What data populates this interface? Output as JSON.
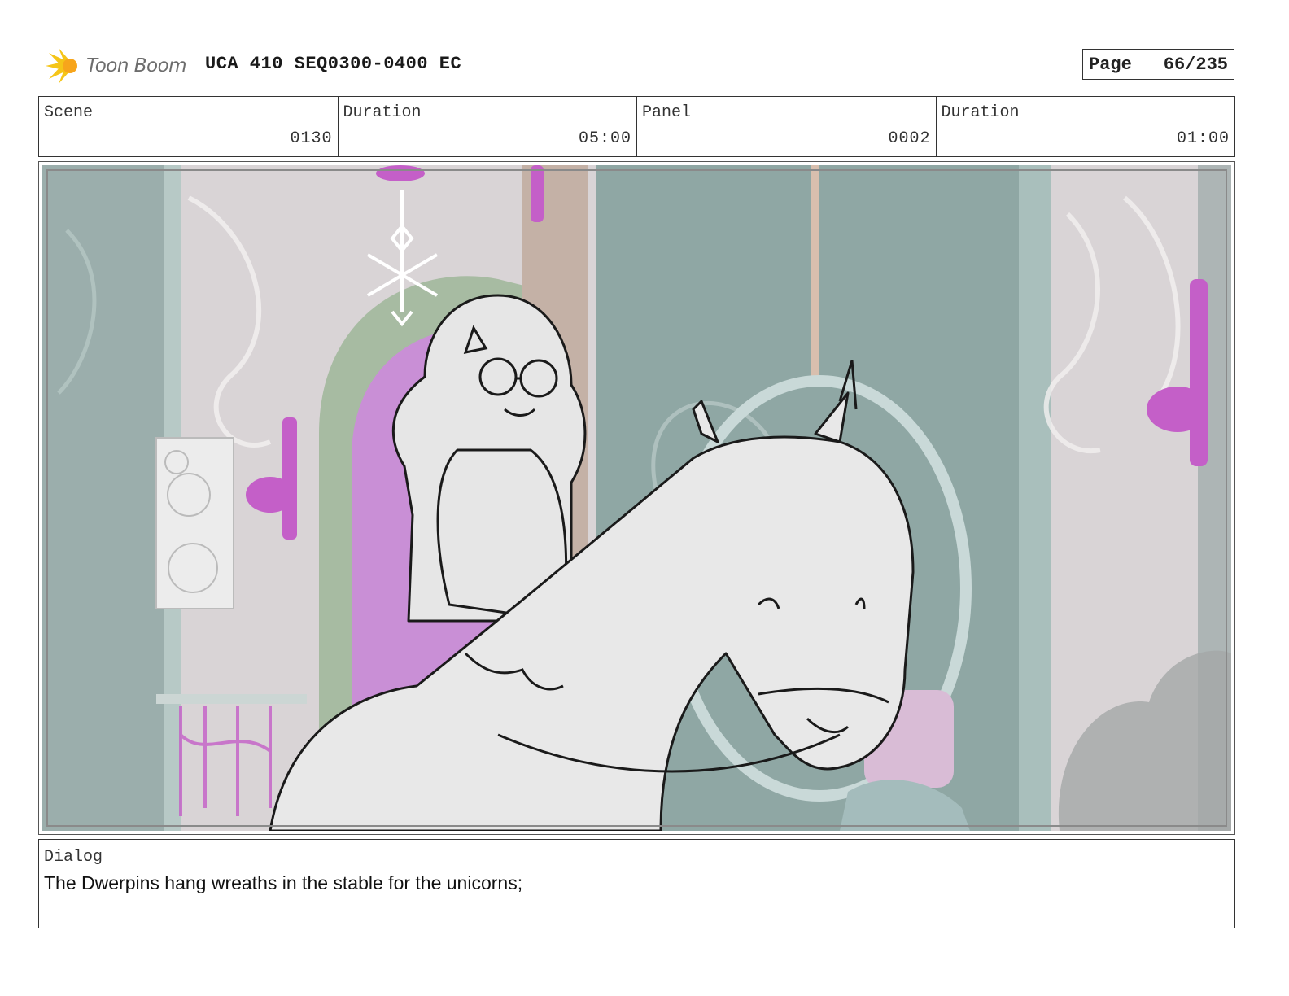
{
  "header": {
    "logo_text": "Toon Boom",
    "doc_title": "UCA 410 SEQ0300-0400 EC",
    "page_label": "Page",
    "page_number": "66/235"
  },
  "info": {
    "scene_label": "Scene",
    "scene_value": "0130",
    "scene_duration_label": "Duration",
    "scene_duration_value": "05:00",
    "panel_label": "Panel",
    "panel_value": "0002",
    "panel_duration_label": "Duration",
    "panel_duration_value": "01:00"
  },
  "panel": {
    "image_subject": "storyboard-sketch"
  },
  "dialog": {
    "label": "Dialog",
    "text": "The Dwerpins hang wreaths in the stable for the unicorns;"
  },
  "colors": {
    "logo_flare": "#f5c518",
    "background_teal": "#8fa7a4",
    "accent_magenta": "#c45fc8",
    "sketch_fill": "#e6e6e6"
  }
}
